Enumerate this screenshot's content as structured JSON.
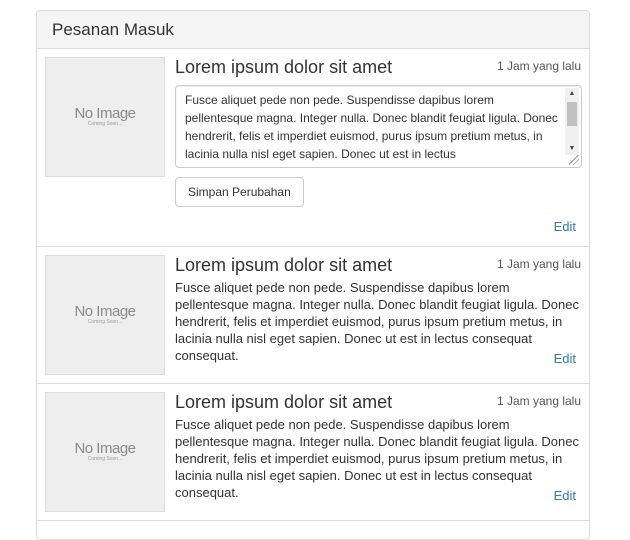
{
  "panel": {
    "heading": "Pesanan Masuk"
  },
  "thumbnail": {
    "main": "No Image",
    "sub": "Coming Soon..."
  },
  "items": [
    {
      "title": "Lorem ipsum dolor sit amet",
      "time": "1 Jam yang lalu",
      "textarea_value": "Fusce aliquet pede non pede. Suspendisse dapibus lorem pellentesque magna. Integer nulla. Donec blandit feugiat ligula. Donec hendrerit, felis et imperdiet euismod, purus ipsum pretium metus, in lacinia nulla nisl eget sapien. Donec ut est in lectus",
      "save_label": "Simpan Perubahan",
      "edit_label": "Edit"
    },
    {
      "title": "Lorem ipsum dolor sit amet",
      "time": "1 Jam yang lalu",
      "body": "Fusce aliquet pede non pede. Suspendisse dapibus lorem pellentesque magna. Integer nulla. Donec blandit feugiat ligula. Donec hendrerit, felis et imperdiet euismod, purus ipsum pretium metus, in lacinia nulla nisl eget sapien. Donec ut est in lectus consequat consequat.",
      "edit_label": "Edit"
    },
    {
      "title": "Lorem ipsum dolor sit amet",
      "time": "1 Jam yang lalu",
      "body": "Fusce aliquet pede non pede. Suspendisse dapibus lorem pellentesque magna. Integer nulla. Donec blandit feugiat ligula. Donec hendrerit, felis et imperdiet euismod, purus ipsum pretium metus, in lacinia nulla nisl eget sapien. Donec ut est in lectus consequat consequat.",
      "edit_label": "Edit"
    }
  ],
  "colors": {
    "link": "#337ab7",
    "heading_bg": "#f5f5f5",
    "border": "#dddddd",
    "thumb_bg": "#eeeeee"
  }
}
